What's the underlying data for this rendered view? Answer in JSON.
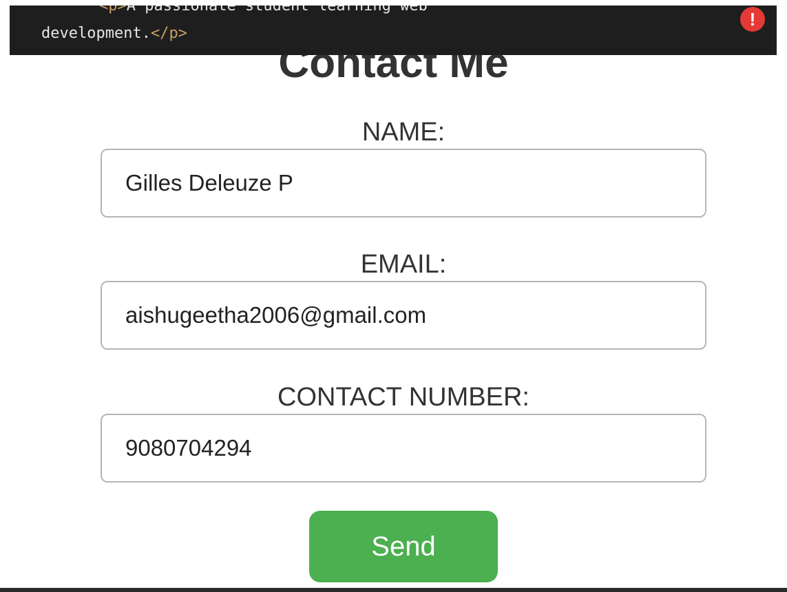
{
  "code_snippet": {
    "line1_open_tag": "<p>",
    "line1_text": "A passionate student learning web",
    "line2_text": "development.",
    "line2_close_tag": "</p>"
  },
  "alert": {
    "symbol": "!",
    "color": "#e53935"
  },
  "contact_form": {
    "title": "Contact Me",
    "name": {
      "label": "NAME:",
      "value": "Gilles Deleuze P"
    },
    "email": {
      "label": "EMAIL:",
      "value": "aishugeetha2006@gmail.com"
    },
    "contact_number": {
      "label": "CONTACT NUMBER:",
      "value": "9080704294"
    },
    "send_label": "Send",
    "button_color": "#4caf50"
  }
}
